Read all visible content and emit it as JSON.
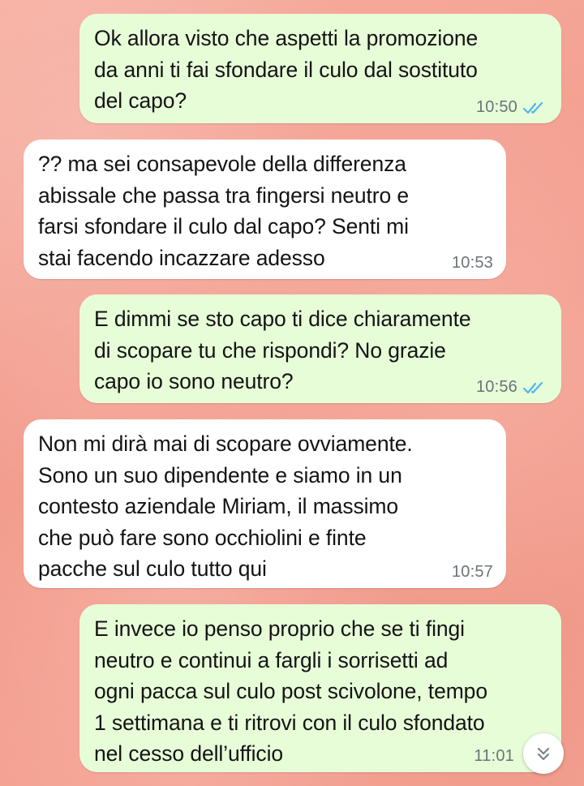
{
  "messages": [
    {
      "direction": "outgoing",
      "text": "Ok allora visto che aspetti la promozione\nda anni ti fai sfondare il culo dal sostituto\ndel capo?",
      "time": "10:50",
      "status": "read-double-check-icon"
    },
    {
      "direction": "incoming",
      "text": "?? ma sei consapevole della differenza\nabissale che passa tra fingersi neutro e\nfarsi sfondare il culo dal capo? Senti mi\nstai facendo incazzare adesso",
      "time": "10:53"
    },
    {
      "direction": "outgoing",
      "text": "E dimmi se sto capo ti dice chiaramente\ndi scopare tu che rispondi? No grazie\ncapo io sono neutro?",
      "time": "10:56",
      "status": "read-double-check-icon"
    },
    {
      "direction": "incoming",
      "text": "Non mi dirà mai di scopare ovviamente.\nSono un suo dipendente e siamo in un\ncontesto aziendale Miriam, il massimo\nche può fare sono occhiolini e finte\npacche sul culo tutto qui",
      "time": "10:57"
    },
    {
      "direction": "outgoing",
      "text": "E invece io penso proprio che se ti fingi\nneutro e continui a fargli i sorrisetti ad\nogni pacca sul culo post scivolone, tempo\n1 settimana e ti ritrovi con il culo sfondato\nnel cesso dell’ufficio",
      "time": "11:01"
    }
  ],
  "scroll_button": {
    "icon": "double-chevron-down-icon"
  },
  "colors": {
    "outgoing_bubble": "#e7fdd8",
    "incoming_bubble": "#ffffff",
    "read_ticks": "#4fb6ec",
    "timestamp": "#6b7378",
    "wallpaper": "#f4a393"
  }
}
